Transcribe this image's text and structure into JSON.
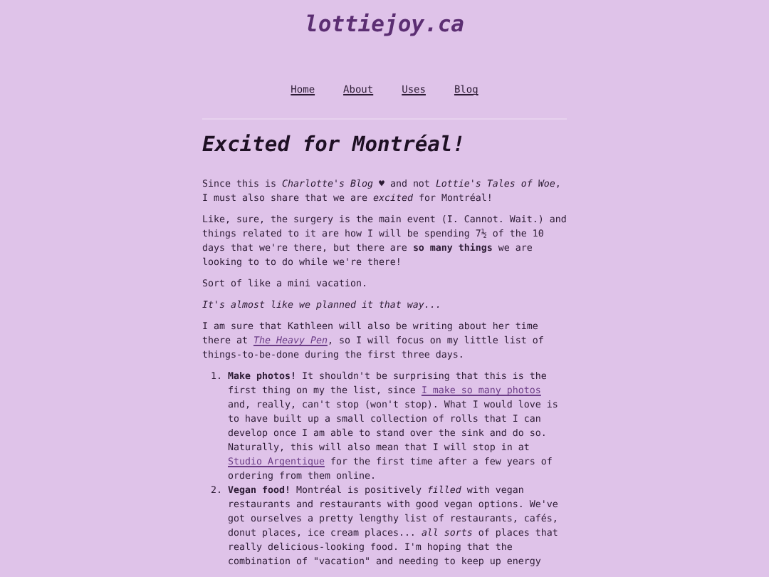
{
  "site": {
    "title": "lottiejoy.ca"
  },
  "nav": [
    {
      "label": "Home"
    },
    {
      "label": "About"
    },
    {
      "label": "Uses"
    },
    {
      "label": "Blog"
    }
  ],
  "post": {
    "title": "Excited for Montréal!",
    "paragraphs": [
      {
        "kind": "plain",
        "parts": [
          {
            "kind": "text",
            "text": "Since this is *Charlotte's Blog* ♥ and not *Lottie's Tales of Woe*, I must also share that we are *excited* for Montréal!"
          }
        ]
      },
      {
        "kind": "plain",
        "parts": [
          {
            "kind": "text",
            "text": "Like, sure, the surgery is the main event (I. Cannot. Wait.) and things related to it are how I will be spending 7½ of the 10 days that we're there, but there are **so many things** we are looking to to do while we're there!"
          }
        ]
      },
      {
        "kind": "plain",
        "parts": [
          {
            "kind": "text",
            "text": "Sort of like a mini vacation."
          }
        ]
      },
      {
        "kind": "italic",
        "parts": [
          {
            "kind": "text",
            "text": "It's almost like we planned it that way..."
          }
        ]
      },
      {
        "kind": "plain",
        "parts": [
          {
            "kind": "text",
            "text": "I am sure that Kathleen will also be writing about her time there at "
          },
          {
            "kind": "link",
            "text": "The Heavy Pen",
            "italic": true
          },
          {
            "kind": "text",
            "text": ", so I will focus on my little list of things-to-be-done during the first three days."
          }
        ]
      }
    ],
    "list": [
      {
        "number": "1.",
        "parts": [
          {
            "kind": "text",
            "text": "**Make photos!** It shouldn't be surprising that this is the first thing on my the list, since "
          },
          {
            "kind": "link",
            "text": "I make so many photos",
            "italic": false
          },
          {
            "kind": "text",
            "text": " and, really, can't stop (won't stop). What I would love is to have built up a small collection of rolls that I can develop once I am able to stand over the sink and do so. Naturally, this will also mean that I will stop in at "
          },
          {
            "kind": "link",
            "text": "Studio Argentique",
            "italic": false
          },
          {
            "kind": "text",
            "text": " for the first time after a few years of ordering from them online."
          }
        ]
      },
      {
        "number": "2.",
        "parts": [
          {
            "kind": "text",
            "text": "**Vegan food!** Montréal is positively *filled* with vegan restaurants and restaurants with good vegan options. We've got ourselves a pretty lengthy list of restaurants, cafés, donut places, ice cream places... *all sorts* of places that really delicious-looking food. I'm hoping that the combination of \"vacation\" and needing to keep up energy"
          }
        ]
      }
    ]
  }
}
